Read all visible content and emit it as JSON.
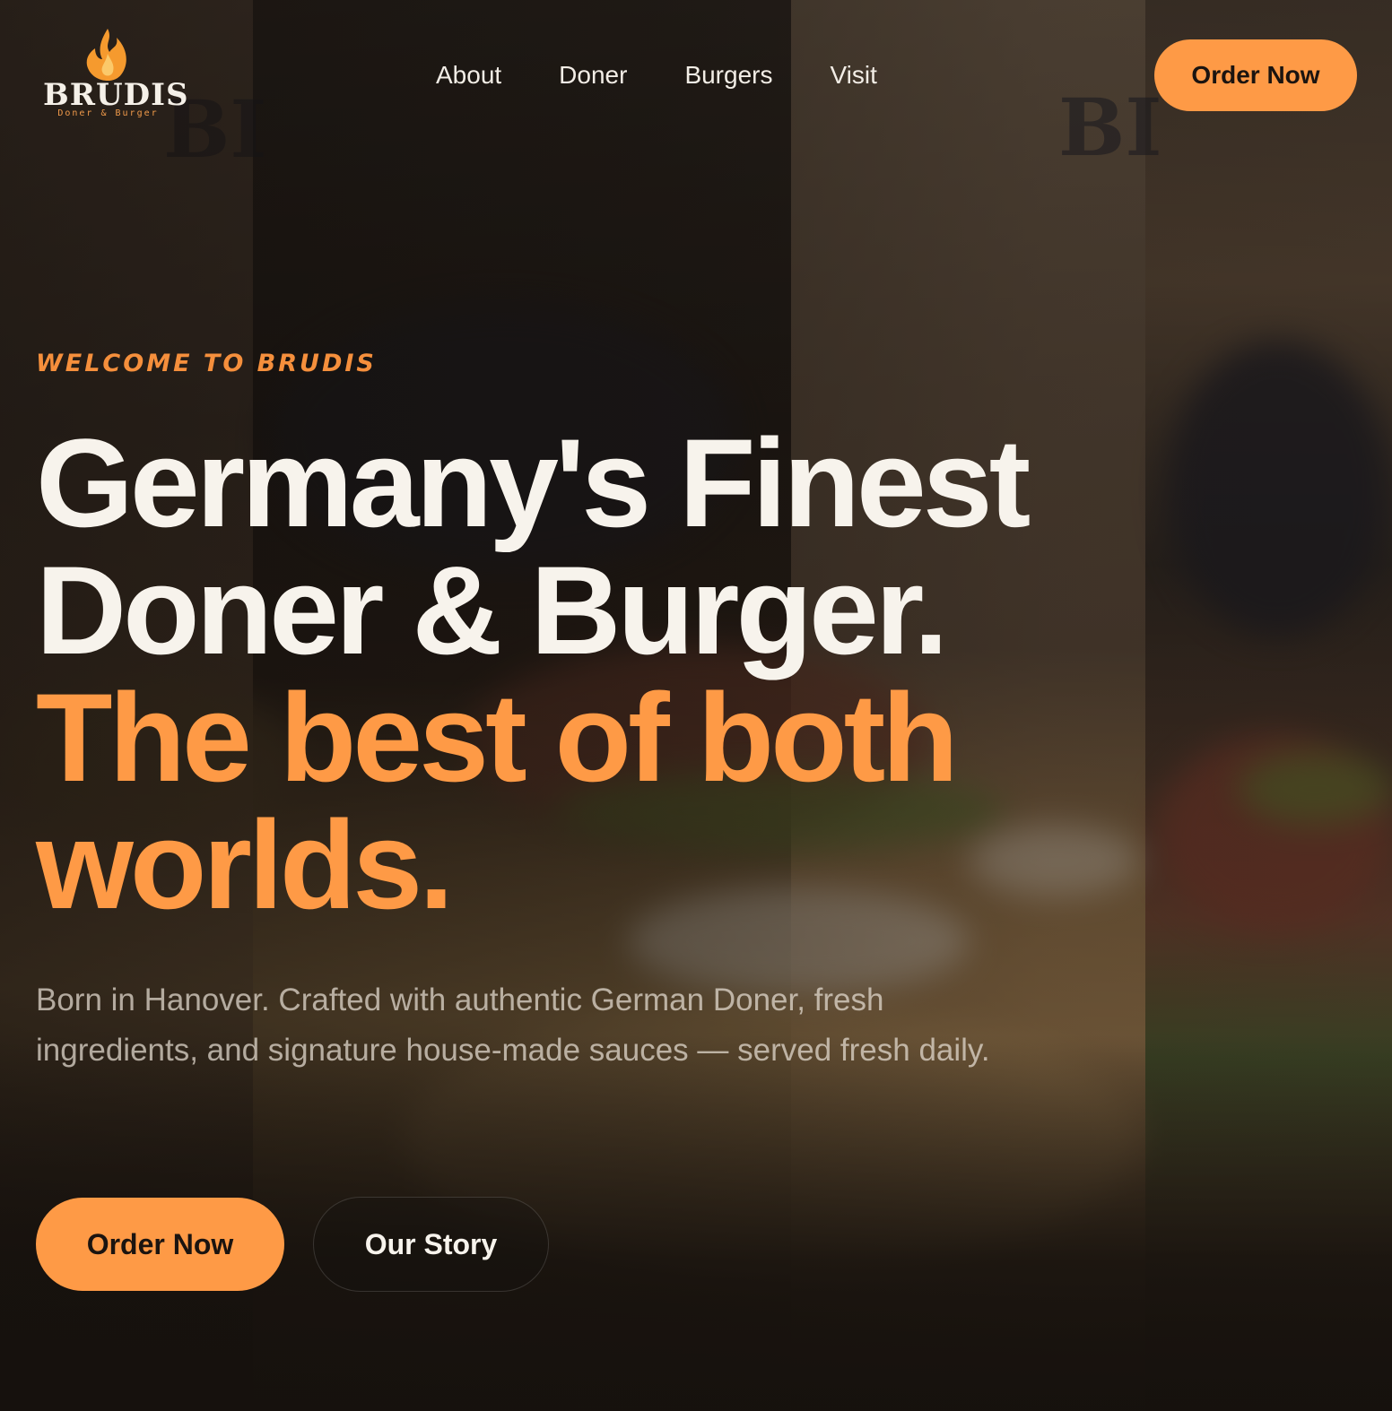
{
  "brand": {
    "name": "BRUDIS",
    "tagline": "Doner & Burger",
    "accent_color": "#fe9a46",
    "flame_icon": "flame-icon"
  },
  "nav": {
    "links": [
      "About",
      "Doner",
      "Burgers",
      "Visit"
    ],
    "order_label": "Order Now"
  },
  "hero": {
    "eyebrow": "Welcome to Brudis",
    "headline_lines": [
      "Germany's Finest",
      "Doner & Burger."
    ],
    "accent_lines": [
      "The best of both",
      "worlds."
    ],
    "subtext": "Born in Hanover. Crafted with authentic German Doner, fresh ingredients, and signature house-made sauces — served fresh daily.",
    "primary_cta": "Order Now",
    "secondary_cta": "Our Story"
  }
}
